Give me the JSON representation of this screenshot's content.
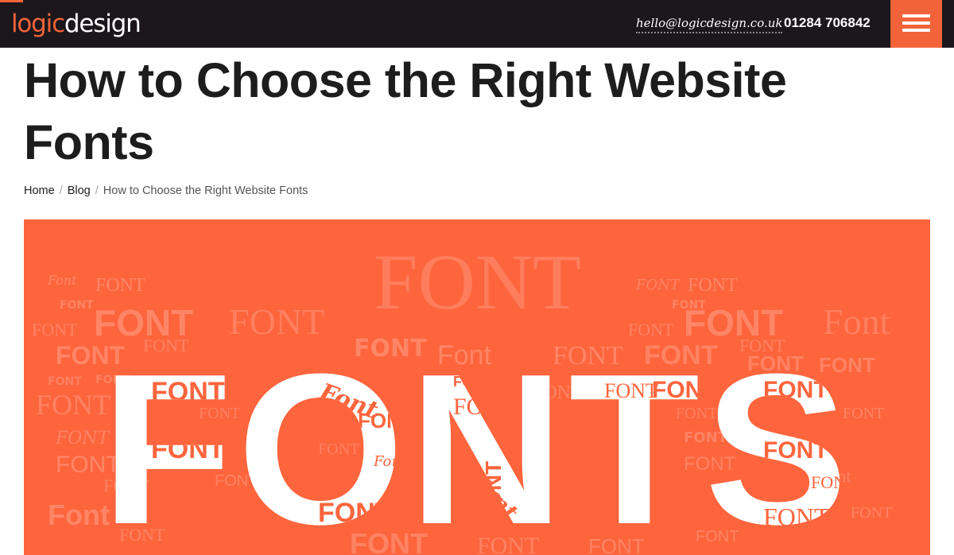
{
  "header": {
    "logo_part1": "logic",
    "logo_part2": "design",
    "email": "hello@logicdesign.co.uk",
    "phone": "01284 706842",
    "menu_icon": "hamburger-menu-icon"
  },
  "article": {
    "title": "How to Choose the Right Website Fonts"
  },
  "breadcrumb": {
    "items": [
      "Home",
      "Blog",
      "How to Choose the Right Website Fonts"
    ],
    "separator": "/"
  },
  "hero": {
    "big_word": "FONTS",
    "background_word": "FONT",
    "script_word": "Font"
  },
  "colors": {
    "accent": "#f2633a",
    "header_bg": "#1b171b",
    "hero_bg": "#fe653d",
    "text": "#1d1d1d"
  }
}
